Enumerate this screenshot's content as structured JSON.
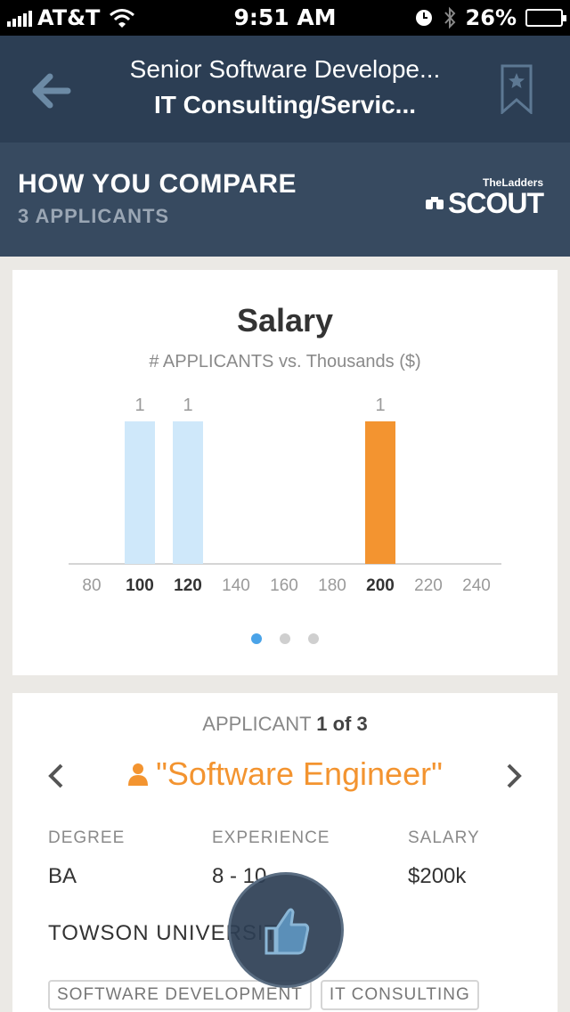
{
  "status_bar": {
    "carrier": "AT&T",
    "time": "9:51 AM",
    "battery": "26%"
  },
  "nav": {
    "title": "Senior Software Develope...",
    "subtitle": "IT Consulting/Servic...",
    "back_icon": "back-arrow-icon",
    "bookmark_icon": "bookmark-icon"
  },
  "compare": {
    "heading": "HOW YOU COMPARE",
    "applicants": "3 APPLICANTS",
    "logo_small": "TheLadders",
    "logo_big": "SCOUT"
  },
  "colors": {
    "nav_bg": "#2c3e54",
    "band_bg": "#374a60",
    "accent": "#f39430",
    "bar_light": "#cfe8fa",
    "page_dot_active": "#4aa3e8"
  },
  "chart_data": {
    "type": "bar",
    "title": "Salary",
    "subtitle": "# APPLICANTS vs. Thousands ($)",
    "categories": [
      "80",
      "100",
      "120",
      "140",
      "160",
      "180",
      "200",
      "220",
      "240"
    ],
    "values": [
      0,
      1,
      1,
      0,
      0,
      0,
      1,
      0,
      0
    ],
    "bold_categories": [
      "100",
      "120",
      "200"
    ],
    "highlight_category": "200",
    "ylim": [
      0,
      1
    ],
    "grid": false
  },
  "pager": {
    "pages": 3,
    "active": 0
  },
  "applicant": {
    "label": "APPLICANT",
    "position": "1 of 3",
    "name": "\"Software Engineer\"",
    "degree_label": "DEGREE",
    "degree": "BA",
    "experience_label": "EXPERIENCE",
    "experience": "8 - 10",
    "salary_label": "SALARY",
    "salary": "$200k",
    "school": "TOWSON UNIVERSITY",
    "tags": [
      "SOFTWARE DEVELOPMENT",
      "IT CONSULTING"
    ]
  }
}
